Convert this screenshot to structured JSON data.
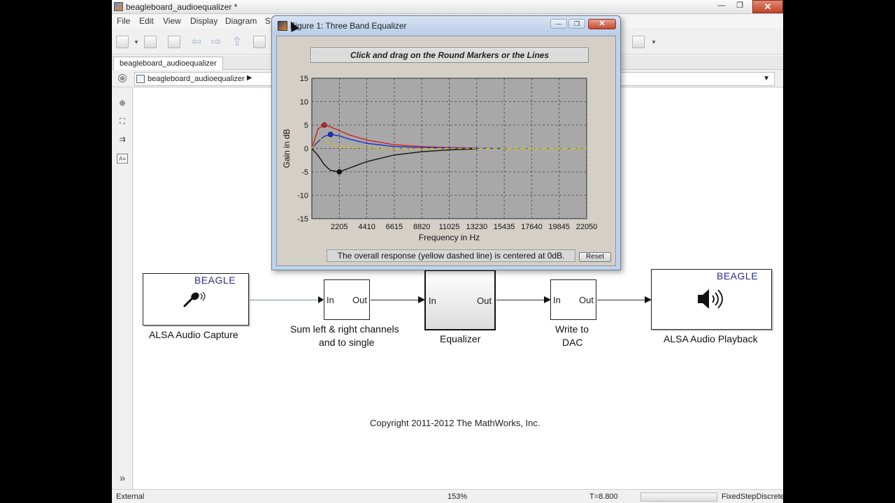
{
  "window": {
    "title": "beagleboard_audioequalizer *",
    "minimize": "—",
    "restore": "❐",
    "close": "✕"
  },
  "menu": [
    "File",
    "Edit",
    "View",
    "Display",
    "Diagram",
    "S"
  ],
  "tab": {
    "label": "beagleboard_audioequalizer"
  },
  "address": {
    "path": "beagleboard_audioequalizer",
    "arrow": "▶",
    "dropdown": "▼",
    "back": "⊕"
  },
  "palette": [
    "⊕",
    "⛶",
    "⇉",
    "A≡"
  ],
  "canvas": {
    "blocks": {
      "capture": {
        "brand": "BEAGLE",
        "caption": "ALSA Audio Capture"
      },
      "sum": {
        "in": "In",
        "out": "Out",
        "caption_line1": "Sum left & right channels",
        "caption_line2": "and to single"
      },
      "equalizer": {
        "in": "In",
        "out": "Out",
        "caption": "Equalizer"
      },
      "dac": {
        "in": "In",
        "out": "Out",
        "caption_line1": "Write to",
        "caption_line2": "DAC"
      },
      "playback": {
        "brand": "BEAGLE",
        "caption": "ALSA Audio Playback"
      }
    },
    "copyright": "Copyright 2011-2012 The MathWorks, Inc."
  },
  "expand_glyph": "»",
  "status": {
    "mode": "External",
    "zoom": "153%",
    "time": "T=8.800",
    "solver": "FixedStepDiscrete"
  },
  "figure": {
    "title": "Figure 1: Three Band Equalizer",
    "banner": "Click and drag on the Round Markers or the Lines",
    "footer": "The overall response (yellow dashed line) is centered at 0dB.",
    "reset": "Reset",
    "minimize": "—",
    "restore": "❐",
    "close": "✕"
  },
  "chart_data": {
    "type": "line",
    "xlabel": "Frequency in Hz",
    "ylabel": "Gain in dB",
    "xlim": [
      0,
      22050
    ],
    "ylim": [
      -15,
      15
    ],
    "xticks": [
      2205,
      4410,
      6615,
      8820,
      11025,
      13230,
      15435,
      17640,
      19845,
      22050
    ],
    "yticks": [
      15,
      10,
      5,
      0,
      -5,
      -10,
      -15
    ],
    "grid": true,
    "background": "#a8a8a8",
    "series": [
      {
        "color": "#d02020",
        "x": [
          0,
          500,
          1000,
          1500,
          2205,
          3000,
          4410,
          6615,
          8820,
          11025,
          13230
        ],
        "y": [
          0,
          4.2,
          5.0,
          4.6,
          3.8,
          2.9,
          1.8,
          0.8,
          0.4,
          0.2,
          0.1
        ],
        "marker": {
          "x": 1000,
          "y": 5.0
        }
      },
      {
        "color": "#1d2fd1",
        "x": [
          0,
          500,
          1000,
          1500,
          2205,
          3000,
          4410,
          6615,
          8820,
          11025,
          13230,
          15435
        ],
        "y": [
          0,
          1.5,
          2.6,
          3.0,
          2.7,
          2.0,
          1.1,
          0.4,
          0.2,
          0.1,
          0.05,
          0
        ],
        "marker": {
          "x": 1500,
          "y": 3.0
        }
      },
      {
        "color": "#111111",
        "x": [
          0,
          500,
          1000,
          1500,
          2205,
          3000,
          4410,
          6615,
          8820,
          11025,
          13230
        ],
        "y": [
          0,
          -1.5,
          -3.5,
          -4.7,
          -5.0,
          -4.2,
          -2.8,
          -1.4,
          -0.7,
          -0.3,
          -0.1
        ],
        "marker": {
          "x": 2205,
          "y": -5.0
        }
      },
      {
        "color": "#d8c200",
        "dashed": true,
        "x": [
          0,
          500,
          1000,
          1500,
          2205,
          3000,
          4410,
          6615,
          8820,
          11025,
          13230,
          15435,
          17640,
          19845,
          22050
        ],
        "y": [
          0,
          2.2,
          1.8,
          1.0,
          0.4,
          0.2,
          0.1,
          0,
          0,
          0,
          0,
          0,
          0,
          0,
          0
        ]
      }
    ]
  }
}
